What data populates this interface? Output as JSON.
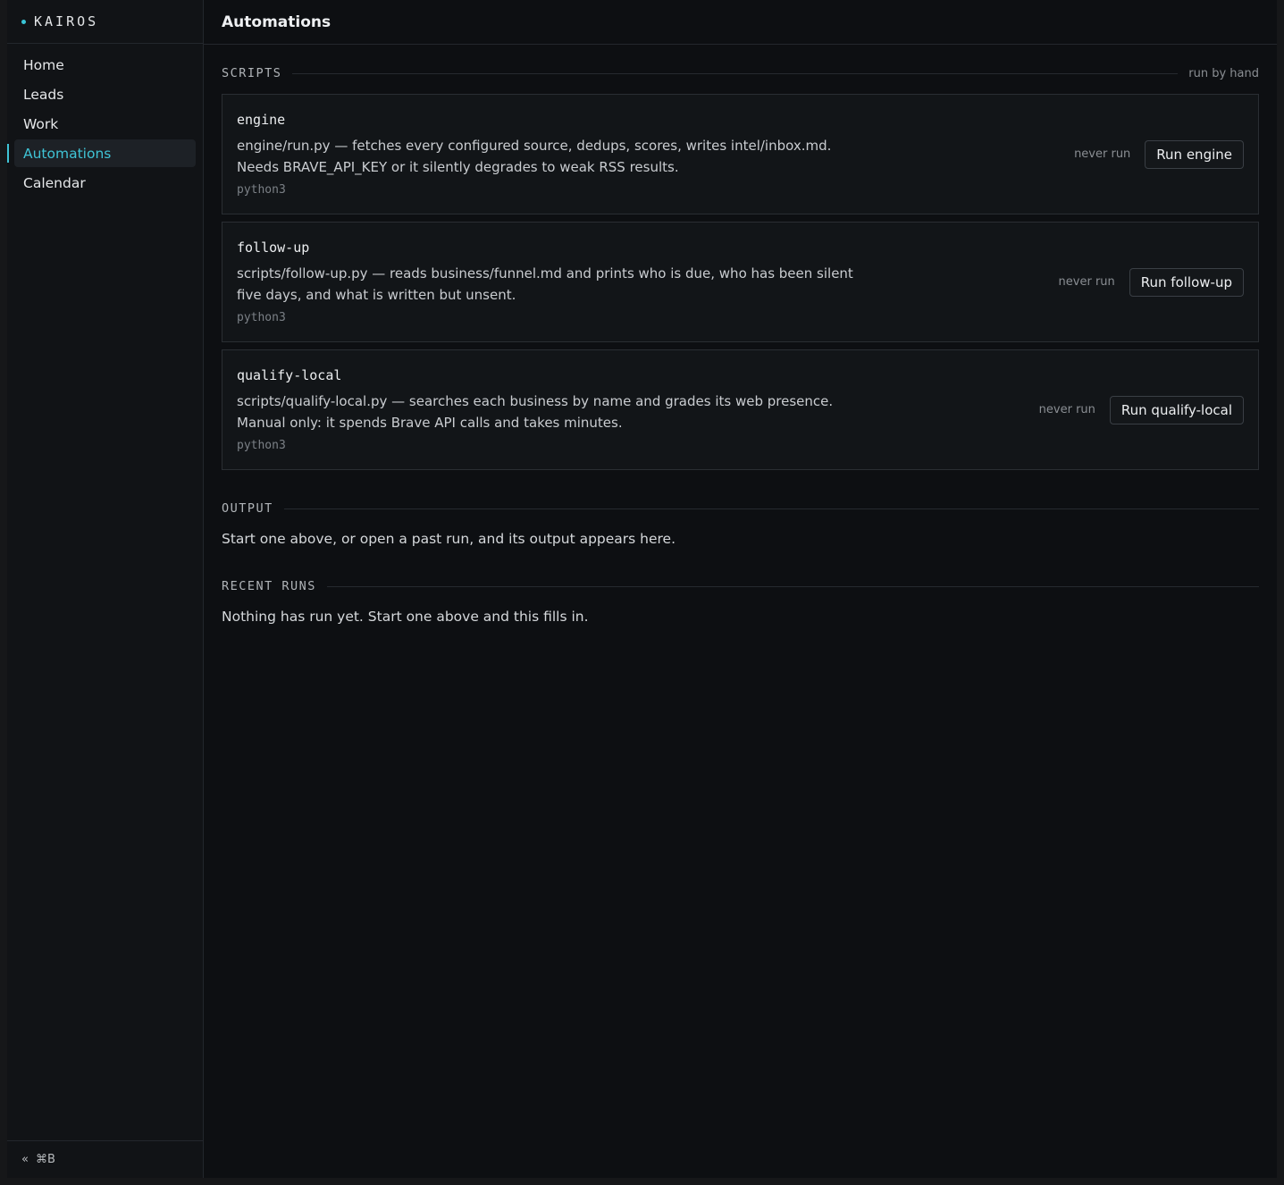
{
  "app": {
    "brand": "KAIROS",
    "accent_color": "#3fc3d5"
  },
  "sidebar": {
    "items": [
      {
        "label": "Home",
        "active": false
      },
      {
        "label": "Leads",
        "active": false
      },
      {
        "label": "Work",
        "active": false
      },
      {
        "label": "Automations",
        "active": true
      },
      {
        "label": "Calendar",
        "active": false
      }
    ],
    "footer": {
      "collapse_icon": "«",
      "shortcut": "⌘B"
    }
  },
  "header": {
    "title": "Automations"
  },
  "scripts_section": {
    "title": "SCRIPTS",
    "note": "run by hand",
    "cards": [
      {
        "name": "engine",
        "description": "engine/run.py — fetches every configured source, dedups, scores, writes intel/inbox.md. Needs BRAVE_API_KEY or it silently degrades to weak RSS results.",
        "runtime": "python3",
        "last_run": "never run",
        "button_label": "Run engine"
      },
      {
        "name": "follow-up",
        "description": "scripts/follow-up.py — reads business/funnel.md and prints who is due, who has been silent five days, and what is written but unsent.",
        "runtime": "python3",
        "last_run": "never run",
        "button_label": "Run follow-up"
      },
      {
        "name": "qualify-local",
        "description": "scripts/qualify-local.py — searches each business by name and grades its web presence. Manual only: it spends Brave API calls and takes minutes.",
        "runtime": "python3",
        "last_run": "never run",
        "button_label": "Run qualify-local"
      }
    ]
  },
  "output_section": {
    "title": "OUTPUT",
    "empty_text": "Start one above, or open a past run, and its output appears here."
  },
  "recent_runs_section": {
    "title": "RECENT RUNS",
    "empty_text": "Nothing has run yet. Start one above and this fills in."
  }
}
